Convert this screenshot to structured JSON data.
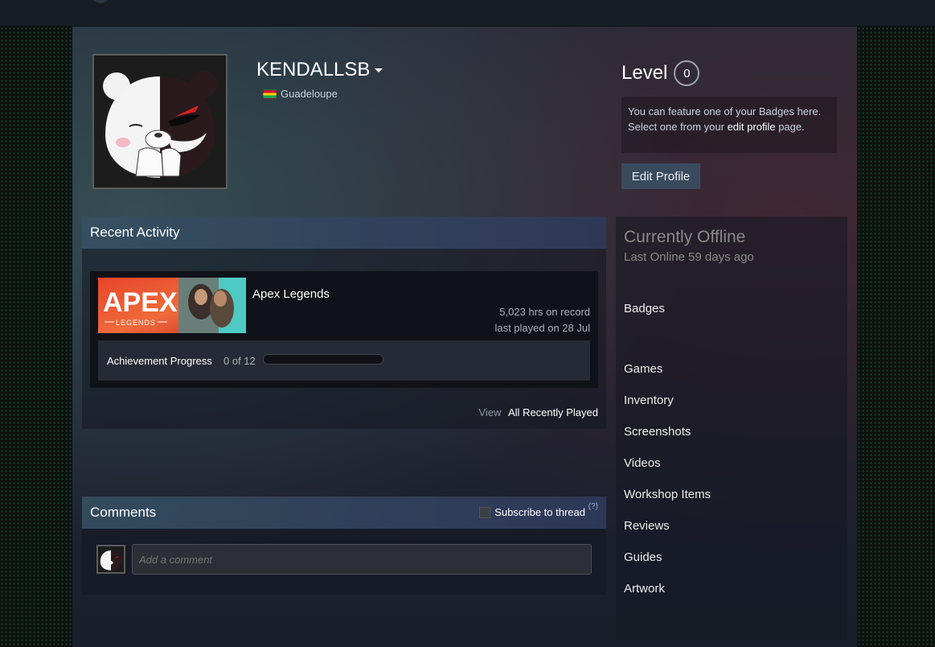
{
  "profile": {
    "persona_name": "KENDALLSB",
    "location": "Guadeloupe",
    "level_label": "Level",
    "level_value": "0",
    "badge_text_1": "You can feature one of your Badges here.",
    "badge_text_2_pre": "Select one from your",
    "badge_text_2_link": "edit profile",
    "badge_text_2_post": "page.",
    "edit_profile_label": "Edit Profile"
  },
  "recent_activity": {
    "title": "Recent Activity",
    "game": {
      "name": "Apex Legends",
      "hours": "5,023 hrs on record",
      "last_played": "last played on 28 Jul",
      "image_text": "APEX",
      "image_subtext": "LEGENDS"
    },
    "achievement_label": "Achievement Progress",
    "achievement_count": "0 of 12",
    "achievement_progress": 0,
    "view_label": "View",
    "view_link": "All Recently Played"
  },
  "comments": {
    "title": "Comments",
    "subscribe_label": "Subscribe to thread",
    "help_label": "(?)",
    "placeholder": "Add a comment"
  },
  "sidebar": {
    "status": "Currently Offline",
    "last_online": "Last Online 59 days ago",
    "links": [
      "Badges",
      "Games",
      "Inventory",
      "Screenshots",
      "Videos",
      "Workshop Items",
      "Reviews",
      "Guides",
      "Artwork"
    ]
  },
  "colors": {
    "accent_button": "#3a4a5e",
    "text_primary": "#ffffff",
    "text_muted": "#898989"
  }
}
